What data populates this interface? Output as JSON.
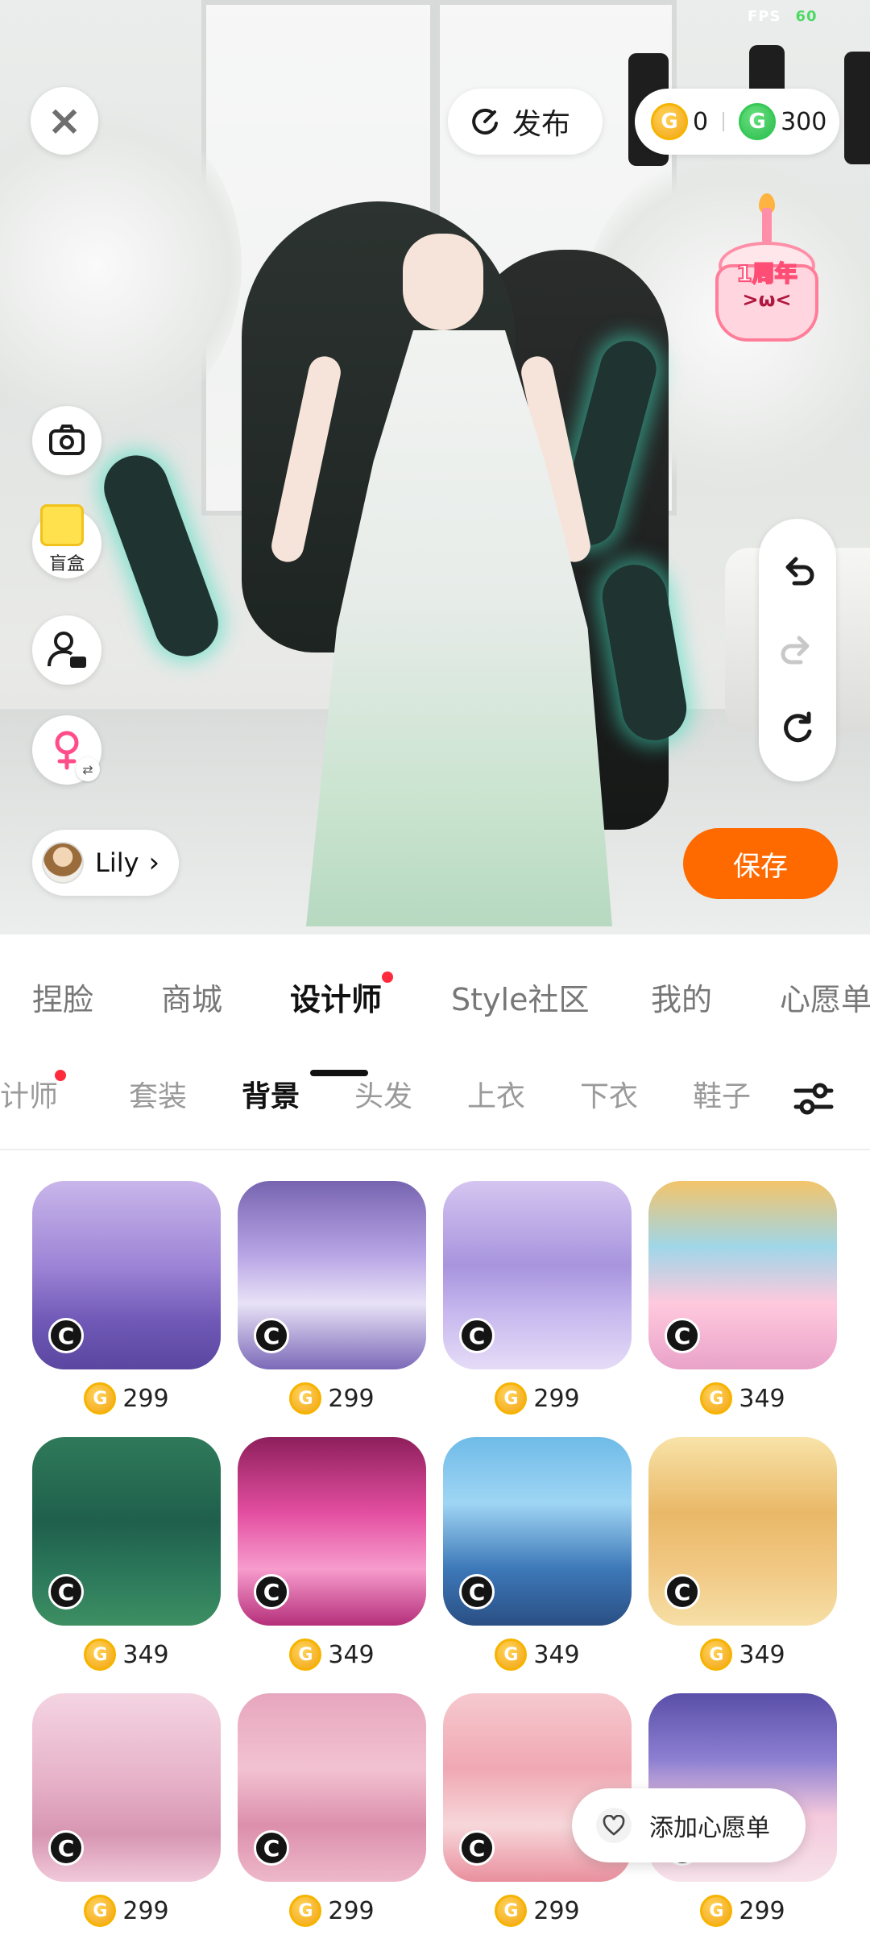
{
  "app": {
    "fps_label": "FPS",
    "fps_value": "60"
  },
  "topbar": {
    "publish_label": "发布",
    "wallet": {
      "gold_amount": "0",
      "green_amount": "300"
    }
  },
  "event_badge": {
    "text": "1周年",
    "face": ">ω<"
  },
  "side_tools": {
    "blind_box_label": "盲盒"
  },
  "profile": {
    "name": "Lily"
  },
  "save_label": "保存",
  "main_tabs": [
    {
      "label": "捏脸"
    },
    {
      "label": "商城"
    },
    {
      "label": "设计师"
    },
    {
      "label": "Style社区"
    },
    {
      "label": "我的"
    },
    {
      "label": "心愿单"
    }
  ],
  "sub_tabs": [
    {
      "label": "设计师"
    },
    {
      "label": "套装"
    },
    {
      "label": "背景"
    },
    {
      "label": "头发"
    },
    {
      "label": "上衣"
    },
    {
      "label": "下衣"
    },
    {
      "label": "鞋子"
    }
  ],
  "items": [
    {
      "price": "299",
      "badge": "C"
    },
    {
      "price": "299",
      "badge": "C"
    },
    {
      "price": "299",
      "badge": "C"
    },
    {
      "price": "349",
      "badge": "C"
    },
    {
      "price": "349",
      "badge": "C"
    },
    {
      "price": "349",
      "badge": "C"
    },
    {
      "price": "349",
      "badge": "C"
    },
    {
      "price": "349",
      "badge": "C"
    },
    {
      "price": "299",
      "badge": "C"
    },
    {
      "price": "299",
      "badge": "C"
    },
    {
      "price": "299",
      "badge": "C"
    },
    {
      "price": "299",
      "badge": "C"
    }
  ],
  "coin_symbol": "G",
  "wishlist_button_label": "添加心愿单",
  "colors": {
    "accent_orange": "#ff6a00",
    "notification_red": "#ff2b3c",
    "gold_coin": "#f6b400",
    "green_coin": "#37c956"
  }
}
